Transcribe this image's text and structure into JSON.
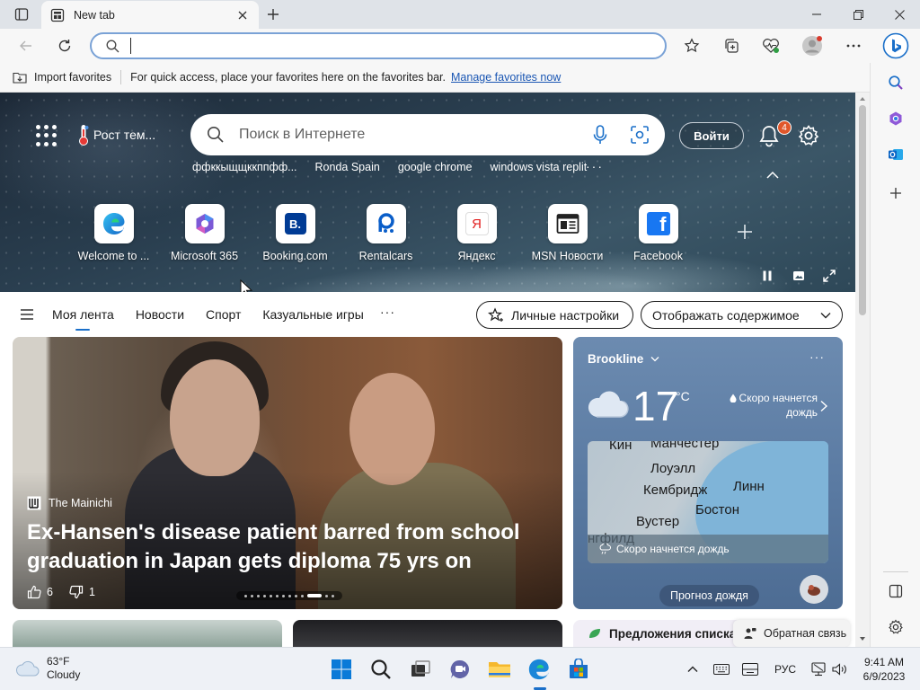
{
  "browser": {
    "tab_title": "New tab",
    "address_value": "",
    "favorites_bar": {
      "import_label": "Import favorites",
      "hint": "For quick access, place your favorites here on the favorites bar.",
      "manage_link": "Manage favorites now"
    }
  },
  "hero": {
    "weather_label": "Рост тем...",
    "search_placeholder": "Поиск в Интернете",
    "login_label": "Войти",
    "notification_count": "4",
    "trending": [
      "ффккыщщккппфф...",
      "Ronda Spain",
      "google chrome",
      "windows vista replit"
    ],
    "quick_links": [
      {
        "label": "Welcome to ...",
        "icon": "edge-icon"
      },
      {
        "label": "Microsoft 365",
        "icon": "m365-icon"
      },
      {
        "label": "Booking.com",
        "icon": "booking-icon",
        "glyph": "B."
      },
      {
        "label": "Rentalcars",
        "icon": "rentalcars-icon"
      },
      {
        "label": "Яндекс",
        "icon": "yandex-icon",
        "glyph": "Я"
      },
      {
        "label": "MSN Новости",
        "icon": "msn-news-icon"
      },
      {
        "label": "Facebook",
        "icon": "facebook-icon",
        "glyph": "f"
      }
    ]
  },
  "feed": {
    "tabs": [
      "Моя лента",
      "Новости",
      "Спорт",
      "Казуальные игры"
    ],
    "personalize_label": "Личные настройки",
    "display_label": "Отображать содержимое"
  },
  "news_card": {
    "source": "The Mainichi",
    "title": "Ex-Hansen's disease patient barred from school graduation in Japan gets diploma 75 yrs on",
    "likes": "6",
    "dislikes": "1"
  },
  "weather_card": {
    "location": "Brookline",
    "temperature": "17",
    "unit": "°C",
    "forecast": "Скоро начнется дождь",
    "map_labels": [
      "Кин",
      "Манчестер",
      "Лоуэлл",
      "Кембридж",
      "Линн",
      "Вустер",
      "Бостон",
      "нгфилд"
    ],
    "map_strip": "Скоро начнется дождь",
    "rain_button": "Прогноз дождя"
  },
  "bottom": {
    "suggestion_label": "Предложения списка стопки",
    "feedback_label": "Обратная связь"
  },
  "taskbar": {
    "temperature": "63°F",
    "condition": "Cloudy",
    "language": "РУС",
    "time": "9:41 AM",
    "date": "6/9/2023"
  },
  "colors": {
    "accent": "#1a6fc9",
    "badge": "#e0572b"
  }
}
